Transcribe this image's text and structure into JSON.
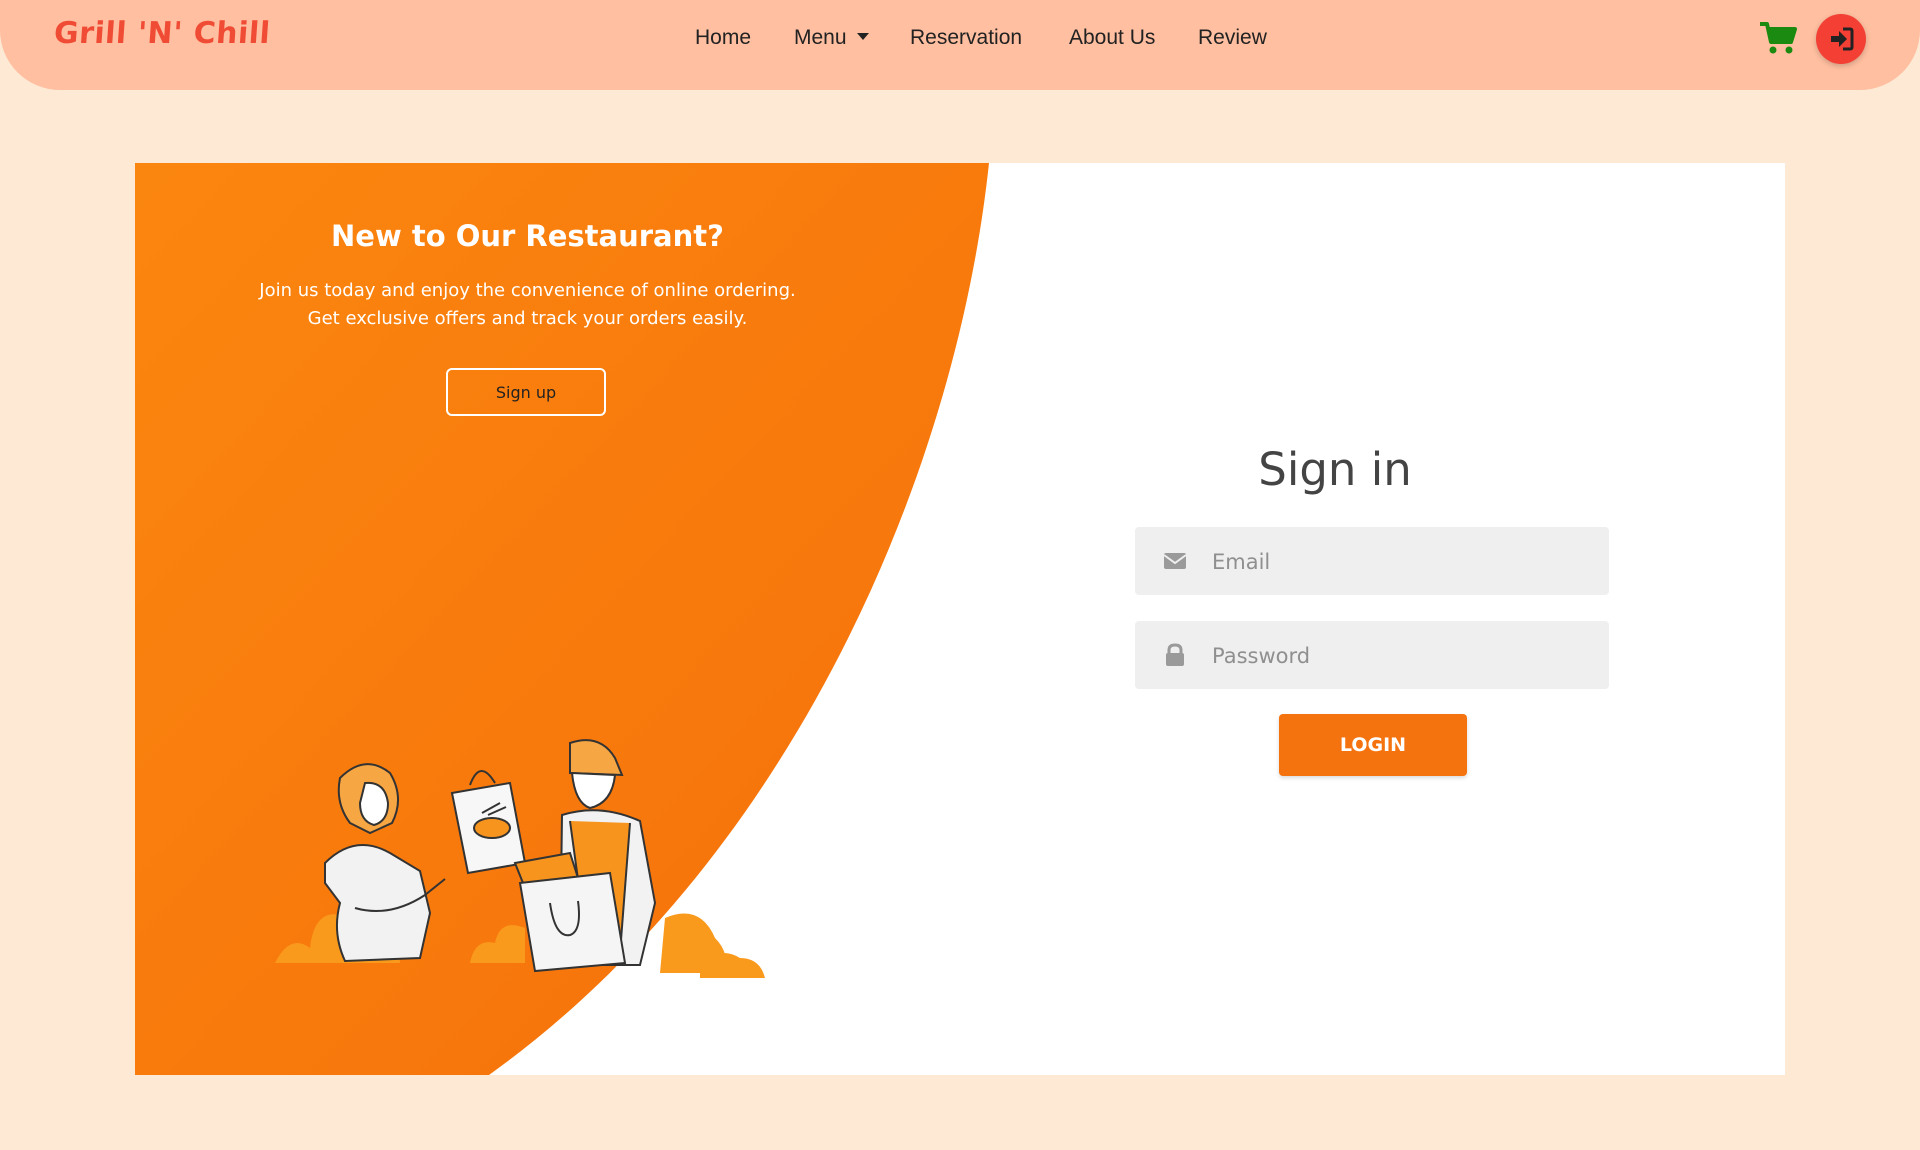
{
  "nav": {
    "brand": "Grill 'N' Chill",
    "links": [
      "Home",
      "Menu",
      "Reservation",
      "About Us",
      "Review"
    ],
    "cart_icon": "cart-icon",
    "login_icon": "sign-in-icon"
  },
  "promo": {
    "title": "New to Our Restaurant?",
    "text_line1": "Join us today and enjoy the convenience of online ordering.",
    "text_line2": "Get exclusive offers and track your orders easily.",
    "signup_label": "Sign up"
  },
  "signin": {
    "title": "Sign in",
    "email_placeholder": "Email",
    "password_placeholder": "Password",
    "login_label": "LOGIN"
  },
  "colors": {
    "page_bg": "#fee9d5",
    "navbar_bg": "#ffbfa0",
    "brand": "#f04c35",
    "orange": "#f5730e",
    "cart": "#1a8a10",
    "login_circle": "#f43f35"
  }
}
